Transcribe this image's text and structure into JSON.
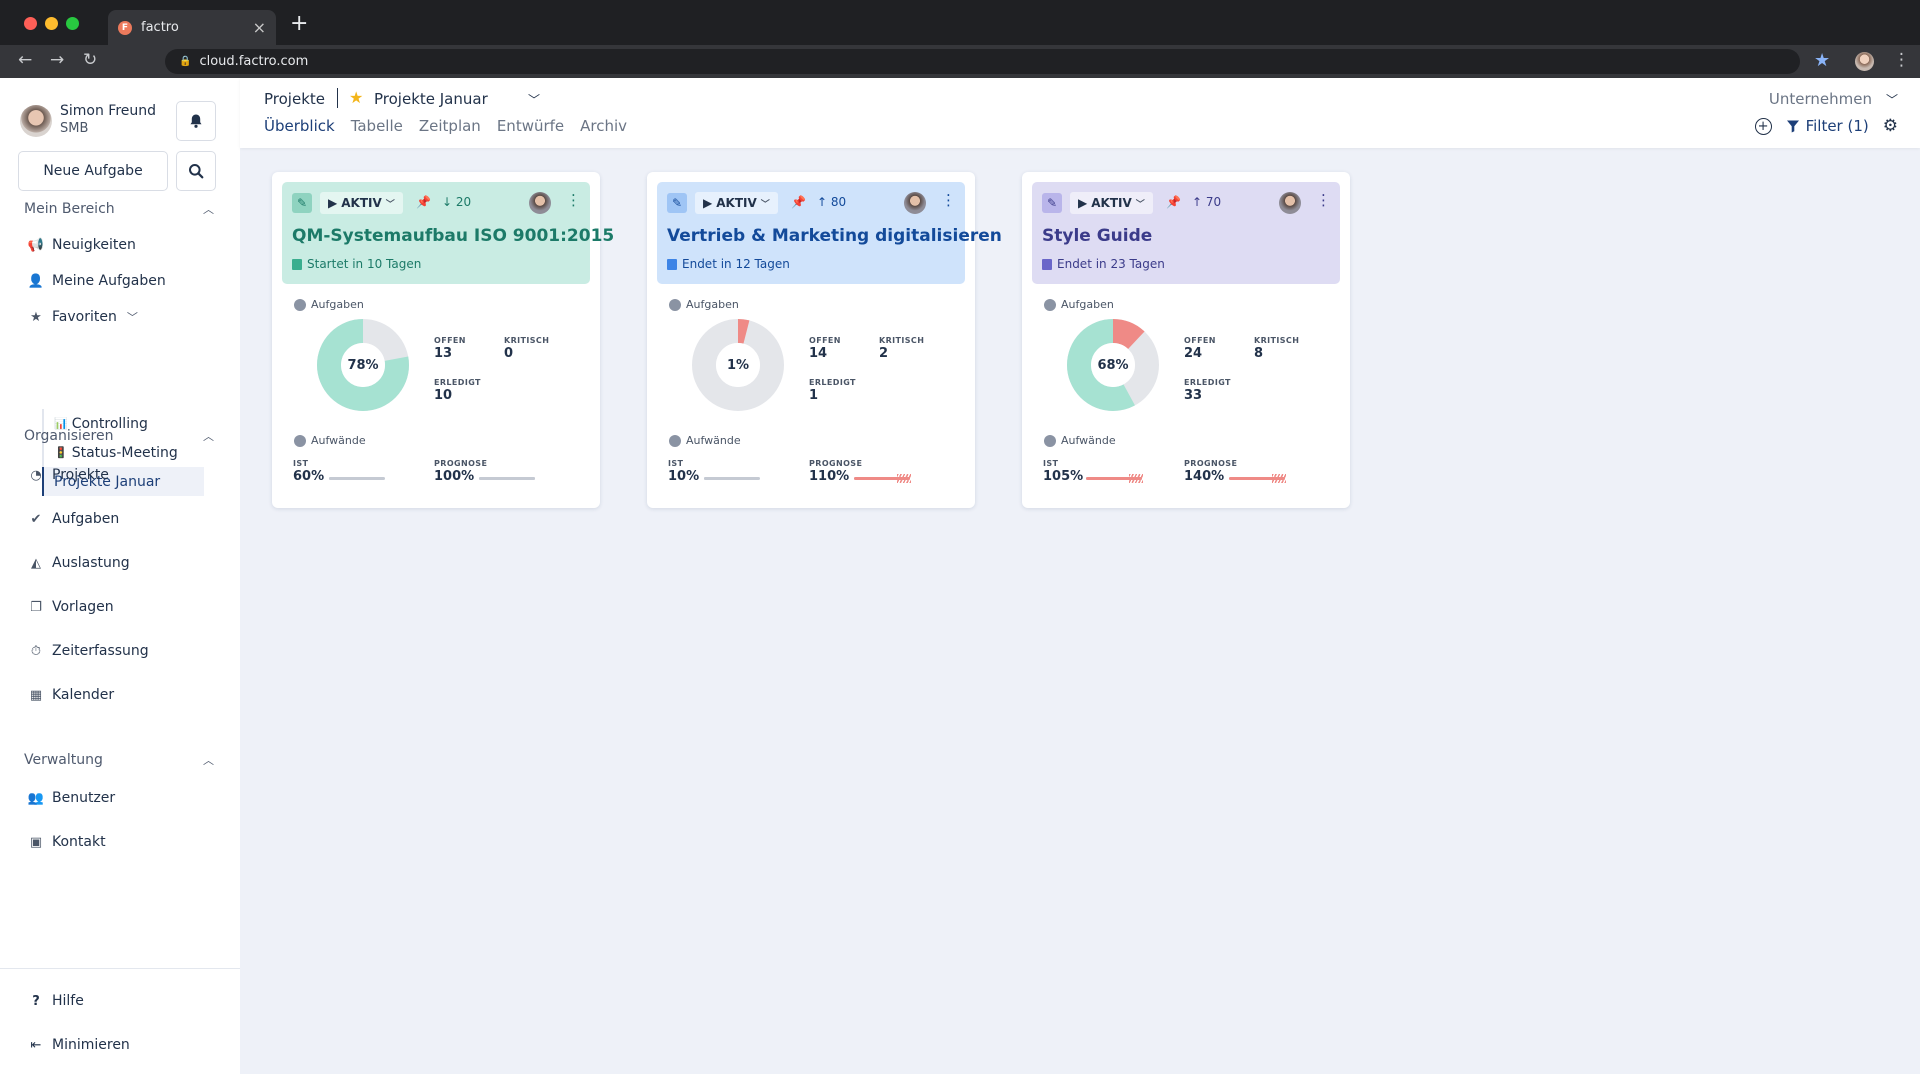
{
  "browser": {
    "tab_title": "factro",
    "tab_favicon": "F",
    "url": "cloud.factro.com"
  },
  "sidebar": {
    "user_name": "Simon Freund",
    "user_role": "SMB",
    "new_task_label": "Neue Aufgabe",
    "sections": {
      "mein_bereich": "Mein Bereich",
      "organisieren": "Organisieren",
      "verwaltung": "Verwaltung"
    },
    "mein_bereich_items": [
      "Neuigkeiten",
      "Meine Aufgaben",
      "Favoriten"
    ],
    "favoriten_items": [
      "Controlling",
      "Status-Meeting",
      "Projekte Januar"
    ],
    "organisieren_items": [
      "Projekte",
      "Aufgaben",
      "Auslastung",
      "Vorlagen",
      "Zeiterfassung",
      "Kalender"
    ],
    "verwaltung_items": [
      "Benutzer",
      "Kontakt"
    ],
    "footer_items": [
      "Hilfe",
      "Minimieren"
    ]
  },
  "header": {
    "crumb_root": "Projekte",
    "crumb_current": "Projekte Januar",
    "tabs": [
      "Überblick",
      "Tabelle",
      "Zeitplan",
      "Entwürfe",
      "Archiv"
    ],
    "active_tab": "Überblick",
    "company_select": "Unternehmen",
    "filter_label": "Filter (1)"
  },
  "labels": {
    "aufgaben": "Aufgaben",
    "aufwaende": "Aufwände",
    "offen": "OFFEN",
    "kritisch": "KRITISCH",
    "erledigt": "ERLEDIGT",
    "ist": "IST",
    "prognose": "PROGNOSE",
    "status": "AKTIV"
  },
  "colors": {
    "brand_dark": "#1d3f78",
    "green_head": "#c9ece3",
    "green_text": "#1c7a68",
    "blue_head": "#cfe3fb",
    "blue_text": "#134a9a",
    "purple_head": "#dedcf3",
    "purple_text": "#3b3b8a",
    "donut_done": "#a6e2d2",
    "donut_critical": "#ef8a86",
    "donut_rest": "#e4e6ea"
  },
  "cards": [
    {
      "title": "QM-Systemaufbau ISO 9001:2015",
      "date_text": "Startet in 10 Tagen",
      "priority_arrow": "↓",
      "priority": "20",
      "percent_label": "78%",
      "done_fraction": 0.78,
      "critical_fraction": 0.0,
      "offen": "13",
      "kritisch": "0",
      "erledigt": "10",
      "ist": "60%",
      "ist_fraction": 0.6,
      "prognose": "100%",
      "prognose_fraction": 1.0
    },
    {
      "title": "Vertrieb & Marketing digitalisieren",
      "date_text": "Endet in 12 Tagen",
      "priority_arrow": "↑",
      "priority": "80",
      "percent_label": "1%",
      "done_fraction": 0.0,
      "critical_fraction": 0.04,
      "offen": "14",
      "kritisch": "2",
      "erledigt": "1",
      "ist": "10%",
      "ist_fraction": 0.1,
      "prognose": "110%",
      "prognose_fraction": 1.1
    },
    {
      "title": "Style Guide",
      "date_text": "Endet in 23 Tagen",
      "priority_arrow": "↑",
      "priority": "70",
      "percent_label": "68%",
      "done_fraction": 0.58,
      "critical_fraction": 0.12,
      "offen": "24",
      "kritisch": "8",
      "erledigt": "33",
      "ist": "105%",
      "ist_fraction": 1.05,
      "prognose": "140%",
      "prognose_fraction": 1.4
    }
  ]
}
